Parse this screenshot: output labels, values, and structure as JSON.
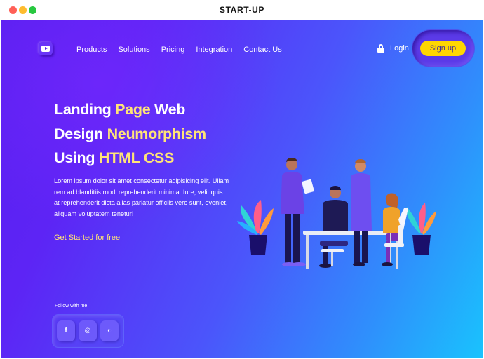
{
  "window": {
    "title": "START-UP"
  },
  "nav": {
    "links": [
      "Products",
      "Solutions",
      "Pricing",
      "Integration",
      "Contact Us"
    ],
    "login": "Login",
    "signup": "Sign up"
  },
  "hero": {
    "title_line1_a": "Landing ",
    "title_line1_b": "Page",
    "title_line1_c": " Web",
    "title_line2_a": "Design ",
    "title_line2_b": "Neumorphism",
    "title_line3_a": "Using ",
    "title_line3_b": "HTML CSS",
    "description": "Lorem ipsum dolor sit amet consectetur adipisicing elit. Ullam rem ad blanditiis modi reprehenderit minima. Iure, velit quis at reprehenderit dicta alias pariatur officiis vero sunt, eveniet, aliquam voluptatem tenetur!",
    "cta": "Get Started for free"
  },
  "social": {
    "label": "Follow with me",
    "buttons": [
      {
        "icon": "facebook-icon",
        "glyph": "f"
      },
      {
        "icon": "dribbble-icon",
        "glyph": "◎"
      },
      {
        "icon": "github-icon",
        "glyph": "◐"
      }
    ]
  },
  "colors": {
    "accent_yellow": "#ffe477",
    "signup_bg": "#ffd600",
    "gradient_start": "#5a1ff0",
    "gradient_end": "#19c3fd"
  }
}
